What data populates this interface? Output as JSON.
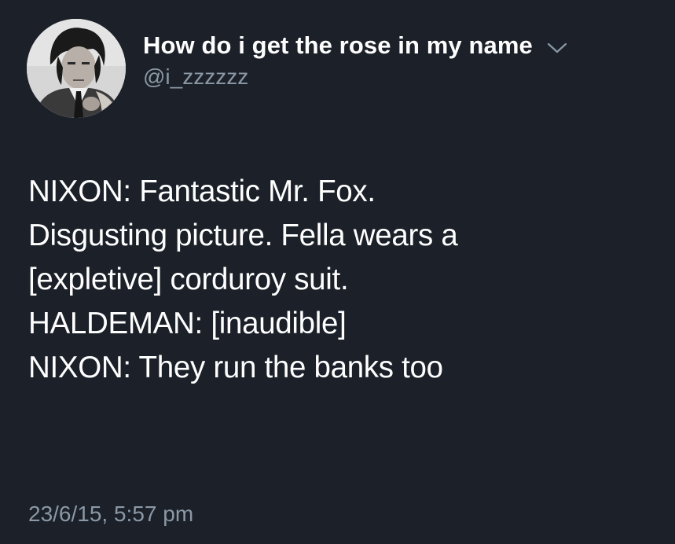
{
  "tweet": {
    "author": {
      "display_name": "How do i get the rose in my name",
      "handle": "@i_zzzzzz",
      "avatar": "profile-photo"
    },
    "icons": {
      "more_options": "chevron-down-icon"
    },
    "lines": [
      "NIXON: Fantastic Mr. Fox.",
      "Disgusting picture. Fella wears a",
      "[expletive] corduroy suit.",
      "HALDEMAN: [inaudible]",
      "NIXON: They run the banks too"
    ],
    "timestamp": "23/6/15, 5:57 pm"
  },
  "colors": {
    "background": "#1b2029",
    "primary_text": "#ffffff",
    "secondary_text": "#8b98a5"
  }
}
